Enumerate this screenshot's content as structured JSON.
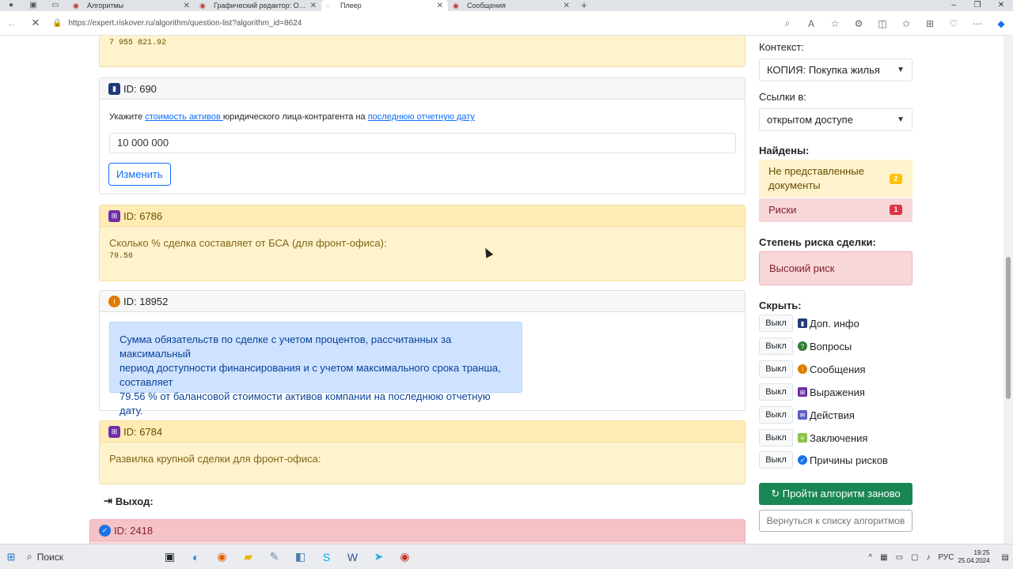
{
  "browser": {
    "tabs": [
      {
        "label": "Алгоритмы",
        "favicon": "riskover-icon"
      },
      {
        "label": "Графический редактор: Отдел...",
        "favicon": "riskover-icon"
      },
      {
        "label": "Плеер",
        "favicon": "loading-icon"
      },
      {
        "label": "Сообщения",
        "favicon": "riskover-icon"
      }
    ],
    "url": "https://expert.riskover.ru/algorithm/question-list?algorithm_id=8624"
  },
  "main": {
    "top_value": "7 955 821.92",
    "q690": {
      "id_label": "ID: 690",
      "prompt_pre": "Укажите ",
      "prompt_link1": "стоимость активов ",
      "prompt_mid": "юридического лица-контрагента на ",
      "prompt_link2": "последнюю отчетную дату",
      "value": "10 000 000",
      "change_label": "Изменить"
    },
    "e6786": {
      "id_label": "ID: 6786",
      "text": "Сколько % сделка составляет от БСА (для фронт-офиса):",
      "value": "79.56"
    },
    "m18952": {
      "id_label": "ID: 18952",
      "line1": "Сумма обязательств по сделке с учетом процентов, рассчитанных за максимальный",
      "line2": "период доступности финансирования и с учетом максимального срока транша, составляет",
      "line3": "79.56 % от балансовой стоимости активов компании на последнюю отчетную дату."
    },
    "e6784": {
      "id_label": "ID: 6784",
      "text": "Развилка крупной сделки для фронт-офиса:"
    },
    "exit_label": "Выход:",
    "r2418": {
      "id_label": "ID: 2418"
    }
  },
  "sidebar": {
    "context_label": "Контекст:",
    "context_value": "КОПИЯ: Покупка жилья",
    "links_label": "Ссылки в:",
    "links_value": "открытом доступе",
    "found_label": "Найдены:",
    "found": [
      {
        "label": "Не представленные документы",
        "count": "2",
        "color": "#ffc107"
      },
      {
        "label": "Риски",
        "count": "1",
        "color": "#dc3545"
      }
    ],
    "risk_degree_label": "Степень риска сделки:",
    "risk_degree_value": "Высокий риск",
    "hide_label": "Скрыть:",
    "hide_items": [
      {
        "button": "Выкл",
        "label": "Доп. инфо",
        "icon": "info-square-icon"
      },
      {
        "button": "Выкл",
        "label": "Вопросы",
        "icon": "questions-icon"
      },
      {
        "button": "Выкл",
        "label": "Сообщения",
        "icon": "message-icon"
      },
      {
        "button": "Выкл",
        "label": "Выражения",
        "icon": "expression-icon"
      },
      {
        "button": "Выкл",
        "label": "Действия",
        "icon": "actions-icon"
      },
      {
        "button": "Выкл",
        "label": "Заключения",
        "icon": "conclusion-icon"
      },
      {
        "button": "Выкл",
        "label": "Причины рисков",
        "icon": "risk-reason-icon"
      }
    ],
    "restart_label": "Пройти алгоритм заново",
    "back_label": "Вернуться к списку алгоритмов"
  },
  "taskbar": {
    "search_label": "Поиск",
    "lang": "РУС",
    "time": "19:25",
    "date": "25.04.2024"
  }
}
